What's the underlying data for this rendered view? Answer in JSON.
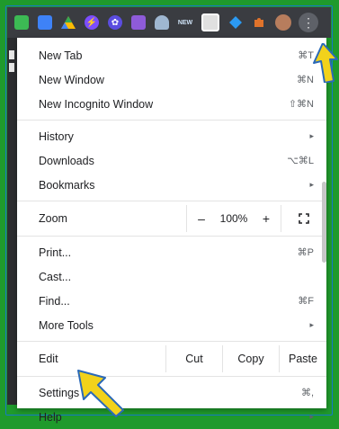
{
  "colors": {
    "background": "#1f9a2c",
    "toolbar": "#3a3c41",
    "menu": "#ffffff",
    "arrow": "#f2d21b",
    "arrow_outline": "#2a69b8"
  },
  "toolbar": {
    "extensions": [
      {
        "icon": "green-square-icon",
        "color": "#3cba54"
      },
      {
        "icon": "blue-window-icon",
        "color": "#3e82f7"
      },
      {
        "icon": "drive-icon",
        "color": "#ffffff"
      },
      {
        "icon": "purple-bolt-icon",
        "color": "#7c4dff"
      },
      {
        "icon": "gear-flower-icon",
        "color": "#5b4de0"
      },
      {
        "icon": "purple-square-icon",
        "color": "#8e5bd9"
      },
      {
        "icon": "cloud-icon",
        "color": "#9fb7d1"
      },
      {
        "icon": "new-badge-icon",
        "label": "NEW"
      },
      {
        "icon": "camera-icon",
        "color": "#e0e0e0"
      },
      {
        "icon": "diamond-icon",
        "color": "#2b9af3"
      },
      {
        "icon": "puzzle-icon",
        "color": "#e0732b"
      }
    ],
    "kebab_label": "⋮"
  },
  "menu": {
    "group1": [
      {
        "label": "New Tab",
        "shortcut": "⌘T"
      },
      {
        "label": "New Window",
        "shortcut": "⌘N"
      },
      {
        "label": "New Incognito Window",
        "shortcut": "⇧⌘N"
      }
    ],
    "group2": [
      {
        "label": "History",
        "shortcut": "▸"
      },
      {
        "label": "Downloads",
        "shortcut": "⌥⌘L"
      },
      {
        "label": "Bookmarks",
        "shortcut": "▸"
      }
    ],
    "zoom": {
      "label": "Zoom",
      "minus": "–",
      "value": "100%",
      "plus": "+"
    },
    "group3": [
      {
        "label": "Print...",
        "shortcut": "⌘P"
      },
      {
        "label": "Cast...",
        "shortcut": ""
      },
      {
        "label": "Find...",
        "shortcut": "⌘F"
      },
      {
        "label": "More Tools",
        "shortcut": "▸"
      }
    ],
    "edit": {
      "label": "Edit",
      "cut": "Cut",
      "copy": "Copy",
      "paste": "Paste"
    },
    "group4": [
      {
        "label": "Settings",
        "shortcut": "⌘,"
      },
      {
        "label": "Help",
        "shortcut": "▸"
      }
    ]
  }
}
